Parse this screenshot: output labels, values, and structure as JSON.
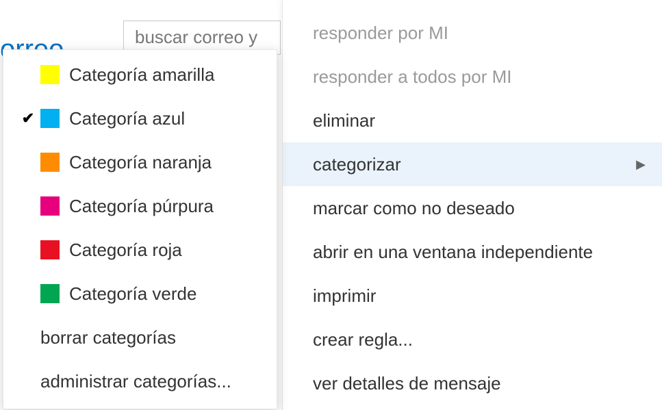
{
  "header": {
    "title": "orreo",
    "search_placeholder": "buscar correo y"
  },
  "categories_submenu": {
    "items": [
      {
        "label": "Categoría amarilla",
        "color": "#ffff00",
        "checked": false
      },
      {
        "label": "Categoría azul",
        "color": "#00b0f0",
        "checked": true
      },
      {
        "label": "Categoría naranja",
        "color": "#ff8c00",
        "checked": false
      },
      {
        "label": "Categoría púrpura",
        "color": "#e6007e",
        "checked": false
      },
      {
        "label": "Categoría roja",
        "color": "#e81123",
        "checked": false
      },
      {
        "label": "Categoría verde",
        "color": "#00a651",
        "checked": false
      }
    ],
    "clear_label": "borrar categorías",
    "manage_label": "administrar categorías..."
  },
  "context_menu": {
    "items": [
      {
        "label": "responder por MI",
        "disabled": true,
        "submenu": false,
        "highlight": false
      },
      {
        "label": "responder a todos por MI",
        "disabled": true,
        "submenu": false,
        "highlight": false
      },
      {
        "label": "eliminar",
        "disabled": false,
        "submenu": false,
        "highlight": false
      },
      {
        "label": "categorizar",
        "disabled": false,
        "submenu": true,
        "highlight": true
      },
      {
        "label": "marcar como no deseado",
        "disabled": false,
        "submenu": false,
        "highlight": false
      },
      {
        "label": "abrir en una ventana independiente",
        "disabled": false,
        "submenu": false,
        "highlight": false
      },
      {
        "label": "imprimir",
        "disabled": false,
        "submenu": false,
        "highlight": false
      },
      {
        "label": "crear regla...",
        "disabled": false,
        "submenu": false,
        "highlight": false
      },
      {
        "label": "ver detalles de mensaje",
        "disabled": false,
        "submenu": false,
        "highlight": false
      }
    ]
  }
}
